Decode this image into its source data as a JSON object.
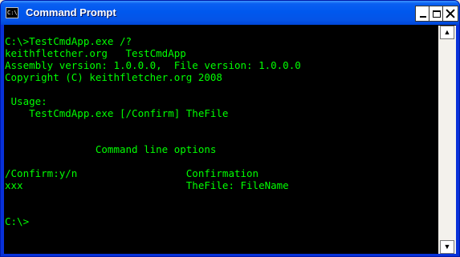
{
  "window": {
    "title": "Command Prompt",
    "icon": {
      "name": "console-app-icon",
      "glyph": "C:\\"
    },
    "controls": {
      "minimize": "minimize-icon",
      "maximize": "maximize-icon",
      "close": "close-icon"
    }
  },
  "console": {
    "text_color": "#00ff00",
    "background": "#000000",
    "lines": [
      "C:\\>TestCmdApp.exe /?",
      "keithfletcher.org   TestCmdApp",
      "Assembly version: 1.0.0.0,  File version: 1.0.0.0",
      "Copyright (C) keithfletcher.org 2008",
      "",
      " Usage:",
      "    TestCmdApp.exe [/Confirm] TheFile",
      "",
      "",
      "               Command line options",
      "",
      "/Confirm:y/n                  Confirmation",
      "xxx                           TheFile: FileName",
      "",
      "",
      "C:\\>"
    ]
  },
  "scrollbar": {
    "up": "scroll-up-arrow-icon",
    "down": "scroll-down-arrow-icon",
    "up_glyph": "▲",
    "down_glyph": "▼"
  }
}
